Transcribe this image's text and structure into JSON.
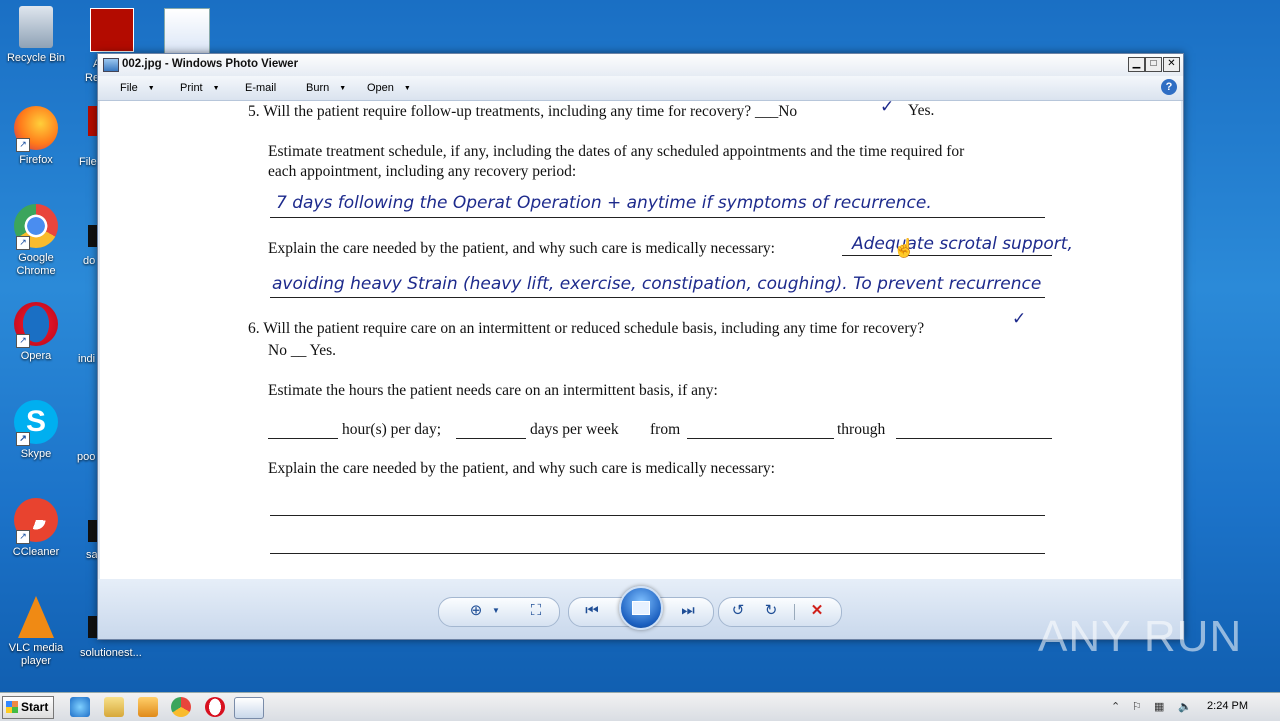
{
  "desktop": {
    "icons": [
      {
        "label": "Recycle Bin"
      },
      {
        "label": "Firefox"
      },
      {
        "label": "Google Chrome"
      },
      {
        "label": "Opera"
      },
      {
        "label": "Skype"
      },
      {
        "label": "CCleaner"
      },
      {
        "label": "VLC media player"
      }
    ],
    "partial_labels": [
      "A",
      "Re",
      "File",
      "do",
      "indi",
      "poo",
      "sa",
      "solutionest..."
    ]
  },
  "window": {
    "title": "002.jpg - Windows Photo Viewer",
    "menu": [
      "File",
      "Print",
      "E-mail",
      "Burn",
      "Open"
    ],
    "help": "?"
  },
  "document": {
    "q5": "5.  Will the patient require follow-up treatments, including any time for recovery? ___No",
    "q5_yes": "Yes.",
    "estimate_line1": "Estimate treatment schedule, if any, including the dates of any scheduled appointments and the time required for",
    "estimate_line2": "each appointment, including any recovery period:",
    "hw1": "7 days following the Operat Operation + anytime if symptoms of recurrence.",
    "explain1": "Explain the care needed by the patient, and why such care is medically necessary:",
    "hw2": "Adequate scrotal support,",
    "hw3": "avoiding heavy Strain (heavy lift, exercise, constipation, coughing). To prevent recurrence",
    "q6": "6.  Will the patient require care on an intermittent or reduced schedule basis, including any time for recovery?",
    "q6_no": "No __ Yes.",
    "estimate_hours": "Estimate the hours the patient needs care on an intermittent basis, if any:",
    "hours_per_day": "hour(s) per day;",
    "days_per_week": "days per week",
    "from": "from",
    "through": "through",
    "explain2": "Explain the care needed by the patient, and why such care is medically necessary:"
  },
  "taskbar": {
    "start": "Start",
    "clock": "2:24 PM"
  },
  "watermark": "ANY RUN"
}
